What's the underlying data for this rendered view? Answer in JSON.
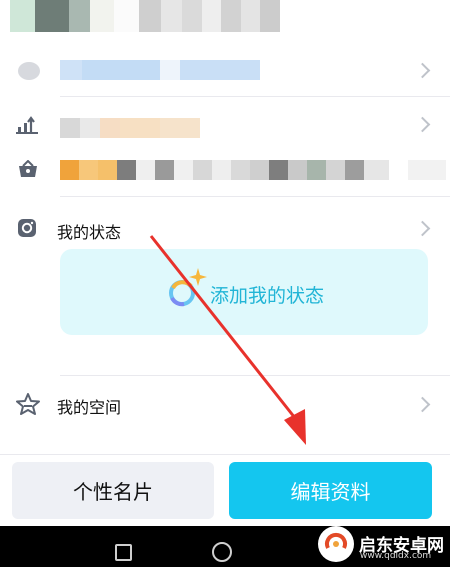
{
  "rows": {
    "status_label": "我的状态",
    "space_label": "我的空间"
  },
  "status_card": {
    "add_label": "添加我的状态"
  },
  "buttons": {
    "card_label": "个性名片",
    "edit_label": "编辑资料"
  },
  "watermark": {
    "site_name": "启东安卓网",
    "site_url": "www.qdldx.com"
  },
  "colors": {
    "accent": "#14c6ef",
    "status_text": "#21b5d6",
    "status_card_bg": "#dff9fc",
    "annotation_arrow": "#e8322c"
  },
  "icons": {
    "row1": "partial-blurred-icon",
    "row2": "rank-arrow-icon",
    "row3": "basket-icon",
    "status": "instagram-camera-icon",
    "space": "star-icon",
    "add_status": "sparkle-ring-icon",
    "nav_home": "circle-home-icon",
    "nav_recent": "square-recent-icon"
  }
}
